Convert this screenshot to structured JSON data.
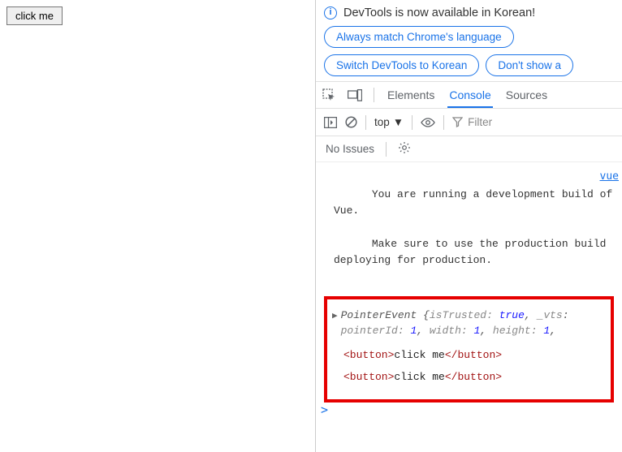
{
  "app": {
    "button_label": "click me"
  },
  "lang": {
    "title": "DevTools is now available in Korean!",
    "match_chrome": "Always match Chrome's language",
    "switch_korean": "Switch DevTools to Korean",
    "dont_show": "Don't show a"
  },
  "tabs": {
    "elements": "Elements",
    "console": "Console",
    "sources": "Sources"
  },
  "subbar": {
    "context": "top",
    "filter_placeholder": "Filter"
  },
  "issues": {
    "label": "No Issues"
  },
  "console": {
    "vue_msg_line1": "You are running a development build of Vue.",
    "vue_msg_line2": "Make sure to use the production build deploying for production.",
    "vue_link": "vue",
    "pointer_event_name": "PointerEvent ",
    "pe_open": "{",
    "pe_close_cont": ", ",
    "pe": {
      "isTrusted_k": "isTrusted: ",
      "isTrusted_v": "true",
      "vts_k": "_vts",
      "pointerId_k": "pointerId: ",
      "pointerId_v": "1",
      "width_k": "width: ",
      "width_v": "1",
      "height_k": "height: ",
      "height_v": "1"
    },
    "btn_open": "<button>",
    "btn_text": "click me",
    "btn_close": "</button>",
    "prompt": ">"
  }
}
